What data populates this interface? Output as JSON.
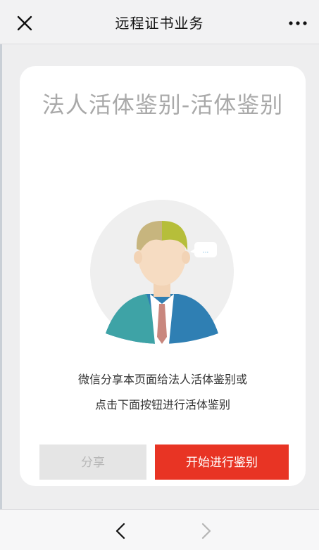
{
  "nav": {
    "title": "远程证书业务",
    "close_icon": "close-icon",
    "more_icon": "more-dots-icon"
  },
  "card": {
    "title": "法人活体鉴别-活体鉴别",
    "illustration": "person-avatar-with-speech-bubble",
    "bubble_text": "...",
    "description_line1": "微信分享本页面给法人活体鉴别或",
    "description_line2": "点击下面按钮进行活体鉴别",
    "share_button": "分享",
    "start_button": "开始进行鉴别"
  },
  "bottombar": {
    "back_icon": "chevron-left-icon",
    "forward_icon": "chevron-right-icon"
  },
  "colors": {
    "accent_red": "#e83424",
    "disabled_gray": "#e5e5e5",
    "title_gray": "#a9a9a9"
  }
}
